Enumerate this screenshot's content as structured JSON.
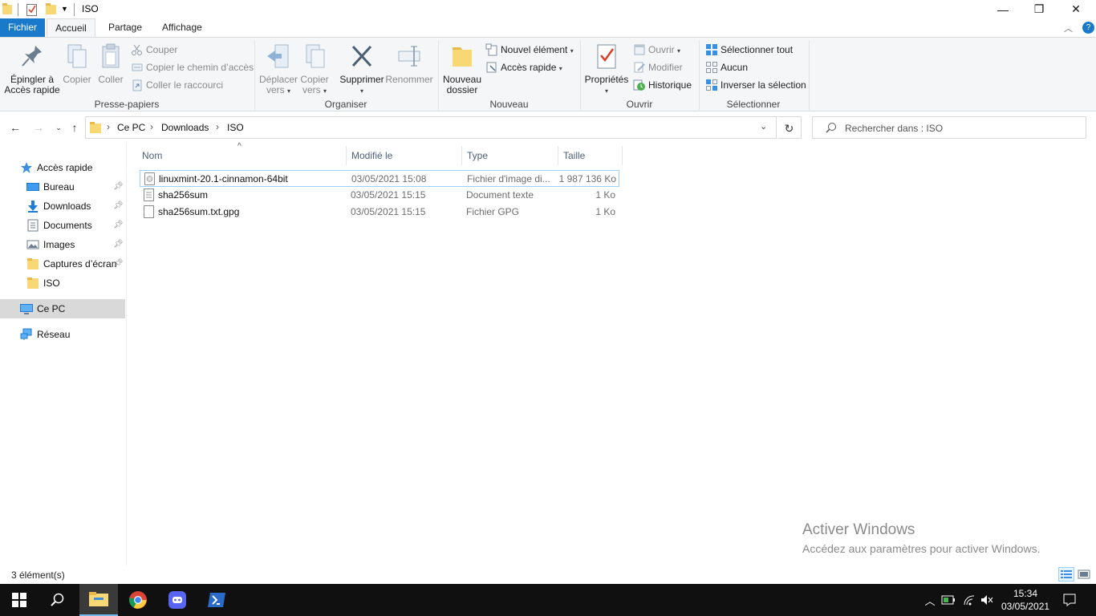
{
  "window": {
    "title": "ISO",
    "minimize": "—",
    "maximize": "❐",
    "close": "✕"
  },
  "ribbon_tabs": {
    "file": "Fichier",
    "home": "Accueil",
    "share": "Partage",
    "view": "Affichage",
    "help": "?"
  },
  "ribbon": {
    "clipboard": {
      "label": "Presse-papiers",
      "pin_line1": "Épingler à",
      "pin_line2": "Accès rapide",
      "copy": "Copier",
      "paste": "Coller",
      "cut": "Couper",
      "copy_path": "Copier le chemin d’accès",
      "paste_shortcut": "Coller le raccourci"
    },
    "organize": {
      "label": "Organiser",
      "move_line1": "Déplacer",
      "move_line2": "vers",
      "copyto_line1": "Copier",
      "copyto_line2": "vers",
      "delete": "Supprimer",
      "rename": "Renommer"
    },
    "new": {
      "label": "Nouveau",
      "new_folder_line1": "Nouveau",
      "new_folder_line2": "dossier",
      "new_item": "Nouvel élément",
      "easy_access": "Accès rapide"
    },
    "open": {
      "label": "Ouvrir",
      "properties": "Propriétés",
      "open": "Ouvrir",
      "edit": "Modifier",
      "history": "Historique"
    },
    "select": {
      "label": "Sélectionner",
      "select_all": "Sélectionner tout",
      "select_none": "Aucun",
      "invert": "Inverser la sélection"
    }
  },
  "address": {
    "crumbs": [
      "Ce PC",
      "Downloads",
      "ISO"
    ],
    "search_placeholder": "Rechercher dans : ISO"
  },
  "nav": {
    "quick_access": "Accès rapide",
    "items": [
      {
        "label": "Bureau",
        "pinned": true
      },
      {
        "label": "Downloads",
        "pinned": true
      },
      {
        "label": "Documents",
        "pinned": true
      },
      {
        "label": "Images",
        "pinned": true
      },
      {
        "label": "Captures d’écran",
        "pinned": true
      },
      {
        "label": "ISO",
        "pinned": false
      }
    ],
    "this_pc": "Ce PC",
    "network": "Réseau"
  },
  "columns": {
    "name": "Nom",
    "modified": "Modifié le",
    "type": "Type",
    "size": "Taille"
  },
  "files": [
    {
      "name": "linuxmint-20.1-cinnamon-64bit",
      "modified": "03/05/2021 15:08",
      "type": "Fichier d'image di...",
      "size": "1 987 136 Ko"
    },
    {
      "name": "sha256sum",
      "modified": "03/05/2021 15:15",
      "type": "Document texte",
      "size": "1 Ko"
    },
    {
      "name": "sha256sum.txt.gpg",
      "modified": "03/05/2021 15:15",
      "type": "Fichier GPG",
      "size": "1 Ko"
    }
  ],
  "status": {
    "count": "3 élément(s)"
  },
  "watermark": {
    "line1": "Activer Windows",
    "line2": "Accédez aux paramètres pour activer Windows."
  },
  "taskbar": {
    "time": "15:34",
    "date": "03/05/2021"
  },
  "colors": {
    "accent": "#1979ca",
    "selection_border": "#99d1ff",
    "folder": "#f8d775",
    "taskbar": "#101010"
  }
}
